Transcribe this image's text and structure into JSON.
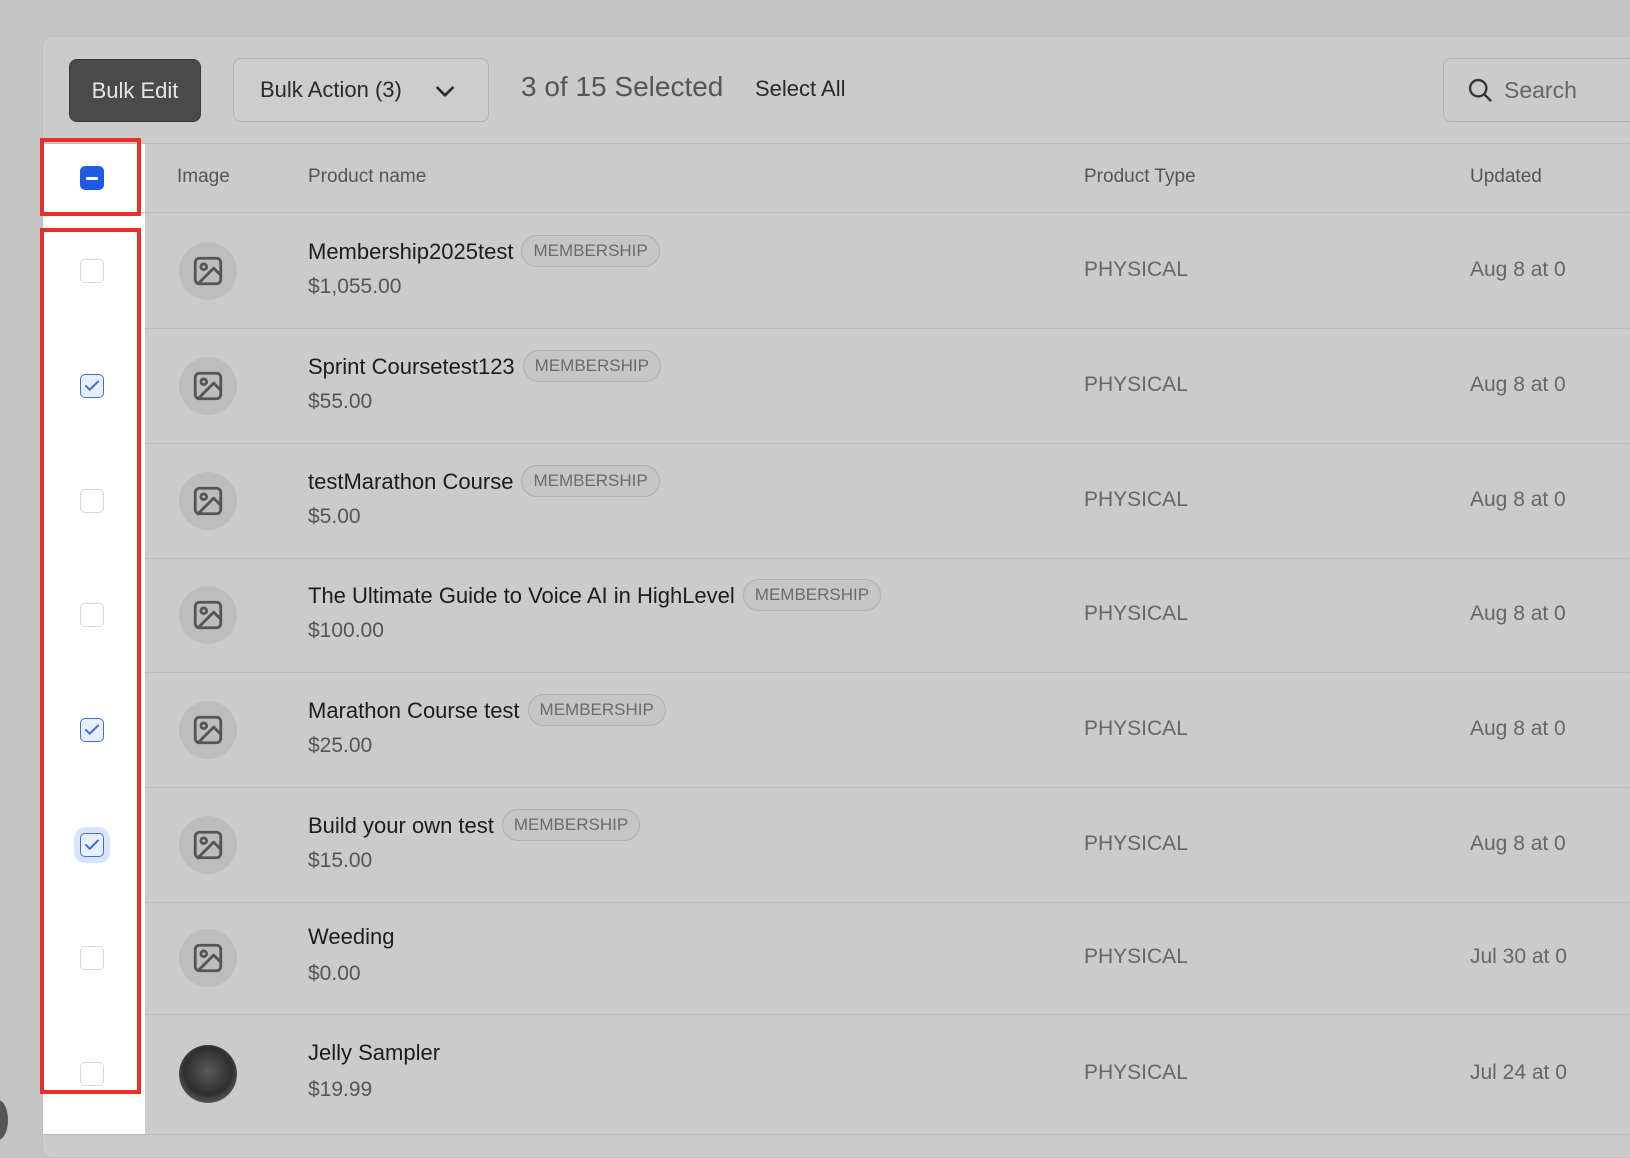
{
  "toolbar": {
    "bulk_edit_label": "Bulk Edit",
    "bulk_action_label": "Bulk Action (3)",
    "selection_status": "3 of 15 Selected",
    "select_all_label": "Select All",
    "search_placeholder": "Search"
  },
  "table": {
    "columns": [
      "Image",
      "Product name",
      "Product Type",
      "Updated"
    ],
    "header_checkbox_state": "indeterminate",
    "rows": [
      {
        "name": "Membership2025test",
        "badge": "MEMBERSHIP",
        "price": "$1,055.00",
        "type": "PHYSICAL",
        "updated": "Aug 8 at 0",
        "checked": false,
        "image": "placeholder"
      },
      {
        "name": "Sprint Coursetest123",
        "badge": "MEMBERSHIP",
        "price": "$55.00",
        "type": "PHYSICAL",
        "updated": "Aug 8 at 0",
        "checked": true,
        "image": "placeholder"
      },
      {
        "name": "testMarathon Course",
        "badge": "MEMBERSHIP",
        "price": "$5.00",
        "type": "PHYSICAL",
        "updated": "Aug 8 at 0",
        "checked": false,
        "image": "placeholder"
      },
      {
        "name": "The Ultimate Guide to Voice AI in HighLevel",
        "badge": "MEMBERSHIP",
        "price": "$100.00",
        "type": "PHYSICAL",
        "updated": "Aug 8 at 0",
        "checked": false,
        "image": "placeholder"
      },
      {
        "name": "Marathon Course test",
        "badge": "MEMBERSHIP",
        "price": "$25.00",
        "type": "PHYSICAL",
        "updated": "Aug 8 at 0",
        "checked": true,
        "image": "placeholder"
      },
      {
        "name": "Build your own test",
        "badge": "MEMBERSHIP",
        "price": "$15.00",
        "type": "PHYSICAL",
        "updated": "Aug 8 at 0",
        "checked": true,
        "image": "placeholder"
      },
      {
        "name": "Weeding",
        "badge": "",
        "price": "$0.00",
        "type": "PHYSICAL",
        "updated": "Jul 30 at 0",
        "checked": false,
        "image": "placeholder"
      },
      {
        "name": "Jelly Sampler",
        "badge": "",
        "price": "$19.99",
        "type": "PHYSICAL",
        "updated": "Jul 24 at 0",
        "checked": false,
        "image": "photo"
      }
    ]
  },
  "icons": {
    "chevron": "chevron-down-icon",
    "search": "search-icon",
    "image_placeholder": "image-placeholder-icon"
  },
  "colors": {
    "highlight": "#e8302a",
    "checkbox_accent": "#1f5ae6"
  }
}
